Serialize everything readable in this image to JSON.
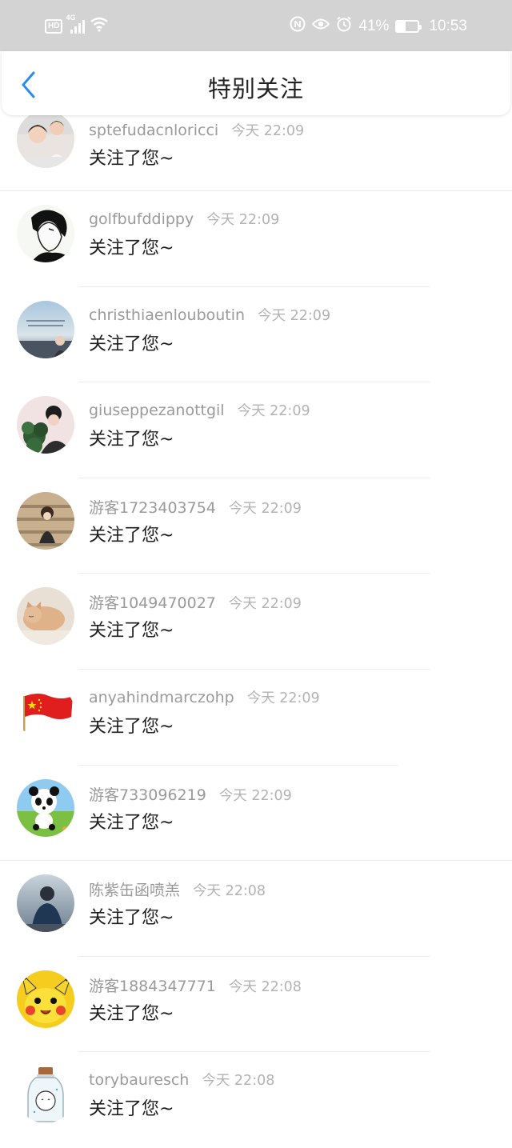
{
  "status_bar": {
    "hd": "HD",
    "network": "4G",
    "battery_percent": "41%",
    "battery_level": 0.41,
    "time": "10:53",
    "icons": [
      "hd-icon",
      "signal-icon",
      "wifi-icon",
      "nfc-icon",
      "eye-icon",
      "alarm-icon",
      "battery-icon"
    ]
  },
  "header": {
    "back_icon": "chevron-left-icon",
    "title": "特别关注"
  },
  "colors": {
    "accent": "#2a8cf0",
    "status_bar_bg": "#d3d3d3",
    "username": "#9a9a9a",
    "timestamp": "#b3b3b3",
    "message": "#1e1e1e"
  },
  "notifications": [
    {
      "username": "sptefudacnloricci",
      "time": "今天 22:09",
      "message": "关注了您~",
      "avatar": "avatar-couple-photo"
    },
    {
      "username": "golfbufddippy",
      "time": "今天 22:09",
      "message": "关注了您~",
      "avatar": "avatar-anime-boy-sketch"
    },
    {
      "username": "christhiaenlouboutin",
      "time": "今天 22:09",
      "message": "关注了您~",
      "avatar": "avatar-sky-girl"
    },
    {
      "username": "giuseppezanottgil",
      "time": "今天 22:09",
      "message": "关注了您~",
      "avatar": "avatar-girl-with-plant"
    },
    {
      "username": "游客1723403754",
      "time": "今天 22:09",
      "message": "关注了您~",
      "avatar": "avatar-girl-stairs"
    },
    {
      "username": "游客1049470027",
      "time": "今天 22:09",
      "message": "关注了您~",
      "avatar": "avatar-sleeping-cat"
    },
    {
      "username": "anyahindmarczohp",
      "time": "今天 22:09",
      "message": "关注了您~",
      "avatar": "avatar-china-flag"
    },
    {
      "username": "游客733096219",
      "time": "今天 22:09",
      "message": "关注了您~",
      "avatar": "avatar-cartoon-panda"
    },
    {
      "username": "陈紫缶函喷羔",
      "time": "今天 22:08",
      "message": "关注了您~",
      "avatar": "avatar-man-in-suit"
    },
    {
      "username": "游客1884347771",
      "time": "今天 22:08",
      "message": "关注了您~",
      "avatar": "avatar-pikachu"
    },
    {
      "username": "torybauresch",
      "time": "今天 22:08",
      "message": "关注了您~",
      "avatar": "avatar-glass-jar"
    }
  ]
}
